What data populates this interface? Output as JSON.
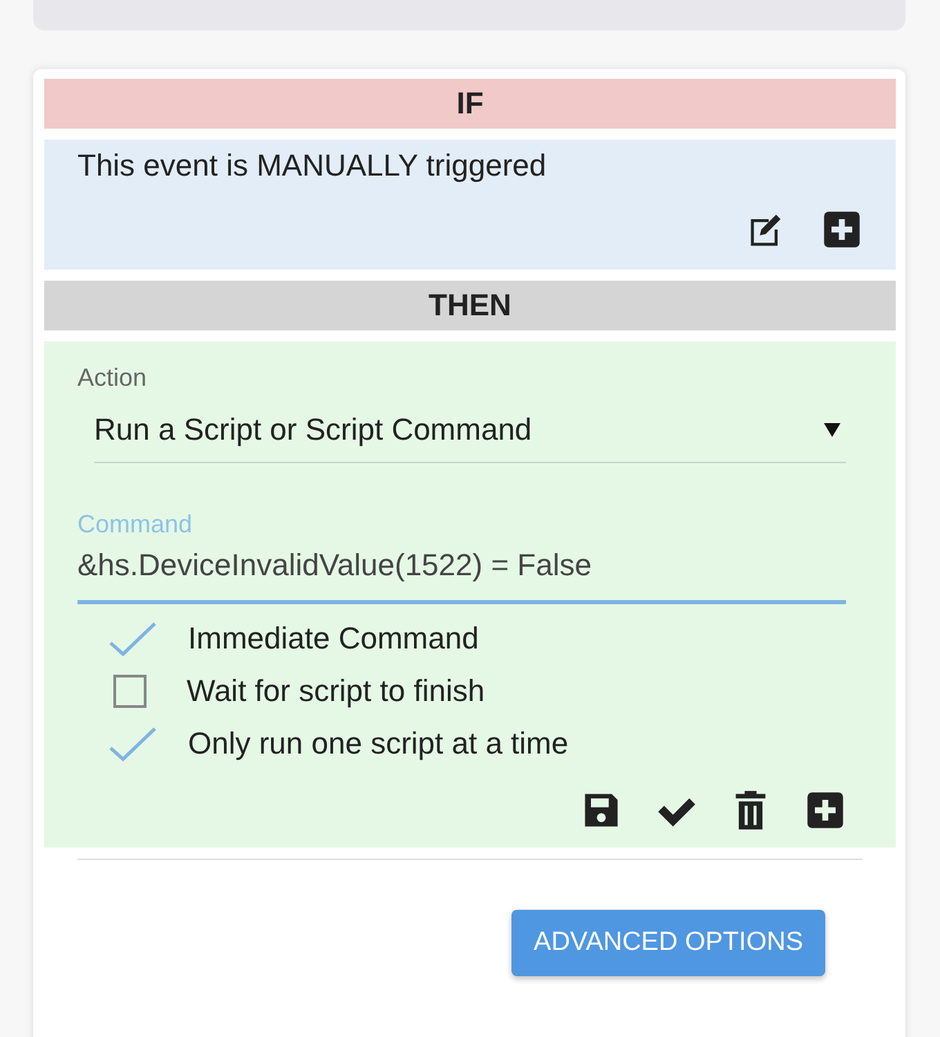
{
  "if_section": {
    "heading": "IF",
    "condition": "This event is MANUALLY triggered",
    "tools": [
      {
        "kind": "edit"
      },
      {
        "kind": "add"
      }
    ]
  },
  "then_section": {
    "heading": "THEN",
    "action_select": {
      "label": "Action",
      "value": "Run a Script or Script Command"
    },
    "command_field": {
      "label": "Command",
      "value": "&hs.DeviceInvalidValue(1522) = False",
      "focused": true
    },
    "options": [
      {
        "label": "Immediate Command",
        "checked": true
      },
      {
        "label": "Wait for script to finish",
        "checked": false
      },
      {
        "label": "Only run one script at a time",
        "checked": true
      }
    ],
    "tools": [
      {
        "kind": "save"
      },
      {
        "kind": "check"
      },
      {
        "kind": "delete"
      },
      {
        "kind": "add"
      }
    ]
  },
  "advanced_button": "ADVANCED OPTIONS"
}
